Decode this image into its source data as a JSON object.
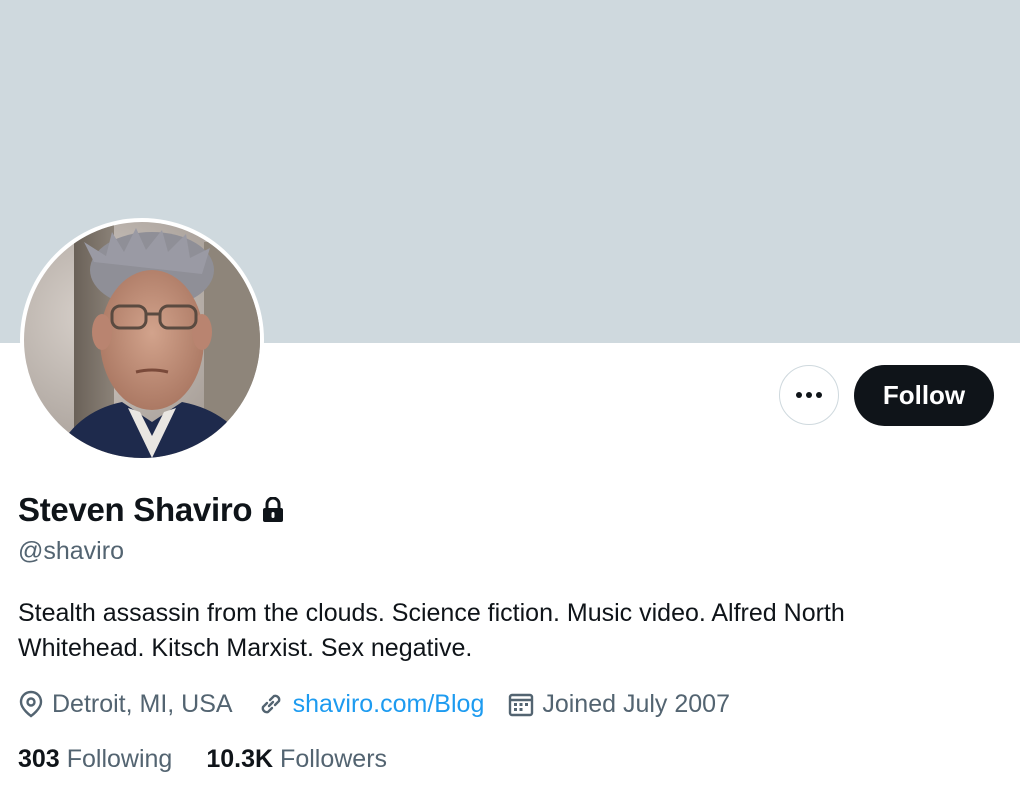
{
  "profile": {
    "display_name": "Steven Shaviro",
    "handle": "@shaviro",
    "bio": "Stealth assassin from the clouds. Science fiction. Music video. Alfred North Whitehead. Kitsch Marxist. Sex negative.",
    "protected_icon": "lock-icon",
    "location": "Detroit, MI, USA",
    "location_icon": "location-pin-icon",
    "website": "shaviro.com/Blog",
    "website_icon": "link-icon",
    "joined": "Joined July 2007",
    "joined_icon": "calendar-icon"
  },
  "actions": {
    "more_icon": "more-options-icon",
    "follow_label": "Follow"
  },
  "stats": {
    "following_count": "303",
    "following_label": "Following",
    "followers_count": "10.3K",
    "followers_label": "Followers"
  },
  "colors": {
    "banner": "#cfd9de",
    "primary_text": "#0f1419",
    "secondary_text": "#536471",
    "link": "#1d9bf0",
    "follow_button_bg": "#0f1419"
  }
}
